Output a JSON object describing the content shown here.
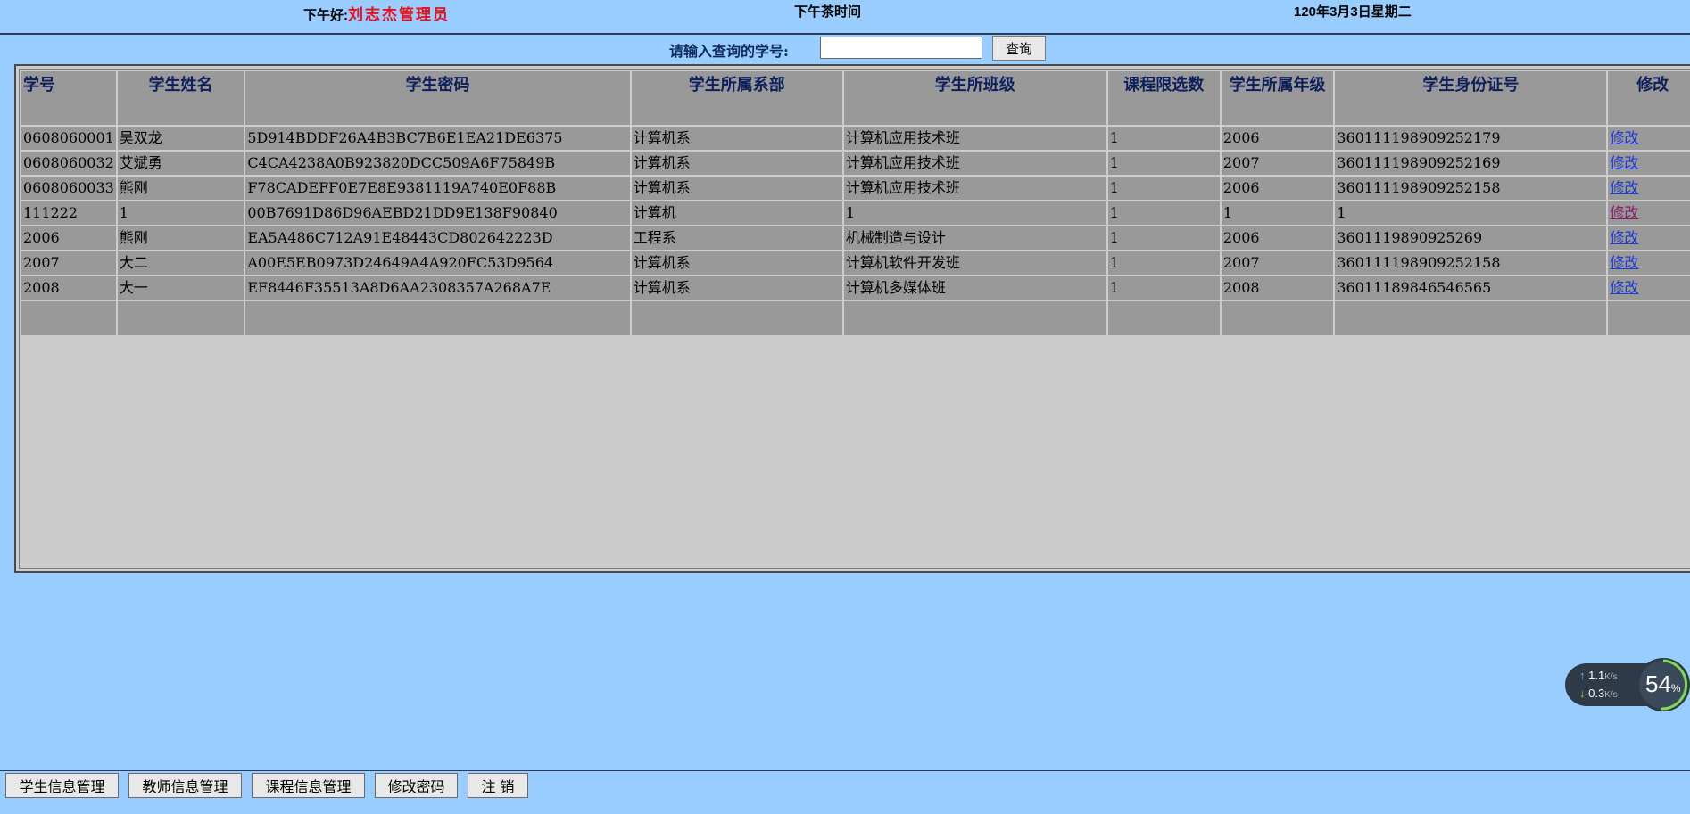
{
  "header": {
    "greeting": "下午好:",
    "user": "刘志杰管理员",
    "slogan": "下午茶时间",
    "date": "120年3月3日星期二"
  },
  "search": {
    "label": "请输入查询的学号:",
    "value": "",
    "button": "查询"
  },
  "table": {
    "columns": [
      "学号",
      "学生姓名",
      "学生密码",
      "学生所属系部",
      "学生所班级",
      "课程限选数",
      "学生所属年级",
      "学生身份证号",
      "修改"
    ],
    "rows": [
      [
        "0608060001",
        "吴双龙",
        "5D914BDDF26A4B3BC7B6E1EA21DE6375",
        "计算机系",
        "计算机应用技术班",
        "1",
        "2006",
        "360111198909252179",
        "修改"
      ],
      [
        "0608060032",
        "艾斌勇",
        "C4CA4238A0B923820DCC509A6F75849B",
        "计算机系",
        "计算机应用技术班",
        "1",
        "2007",
        "360111198909252169",
        "修改"
      ],
      [
        "0608060033",
        "熊刚",
        "F78CADEFF0E7E8E9381119A740E0F88B",
        "计算机系",
        "计算机应用技术班",
        "1",
        "2006",
        "360111198909252158",
        "修改"
      ],
      [
        "111222",
        "1",
        "00B7691D86D96AEBD21DD9E138F90840",
        "计算机",
        "1",
        "1",
        "1",
        "1",
        "修改"
      ],
      [
        "2006",
        "熊刚",
        "EA5A486C712A91E48443CD802642223D",
        "工程系",
        "机械制造与设计",
        "1",
        "2006",
        "3601119890925269",
        "修改"
      ],
      [
        "2007",
        "大二",
        "A00E5EB0973D24649A4A920FC53D9564",
        "计算机系",
        "计算机软件开发班",
        "1",
        "2007",
        "360111198909252158",
        "修改"
      ],
      [
        "2008",
        "大一",
        "EF8446F35513A8D6AA2308357A268A7E",
        "计算机系",
        "计算机多媒体班",
        "1",
        "2008",
        "36011189846546565",
        "修改"
      ]
    ]
  },
  "speed_widget": {
    "upload": "1.1",
    "download": "0.3",
    "unit": "K/s",
    "percent": "54",
    "percent_sign": "%"
  },
  "nav": {
    "items": [
      "学生信息管理",
      "教师信息管理",
      "课程信息管理",
      "修改密码",
      "注 销"
    ]
  }
}
